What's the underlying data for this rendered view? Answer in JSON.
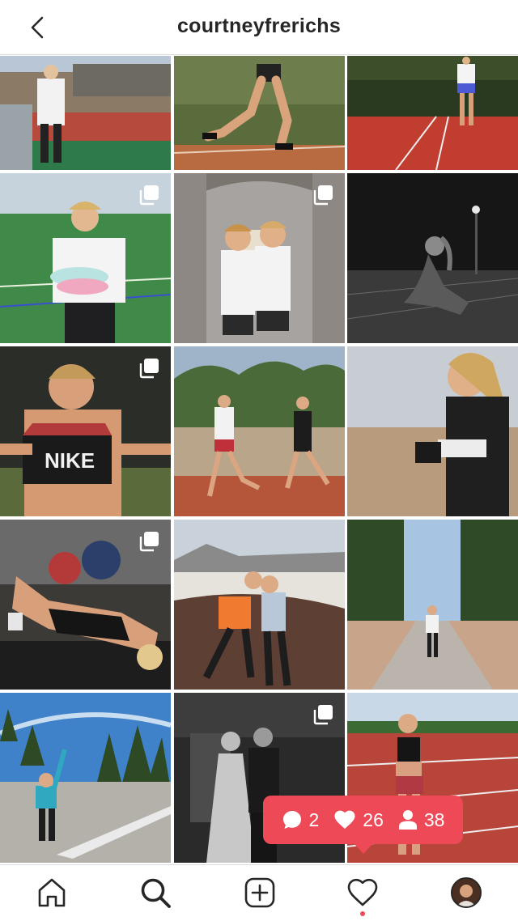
{
  "header": {
    "username": "courtneyfrerichs",
    "back_icon": "chevron-left-icon"
  },
  "grid": {
    "posts": [
      {
        "name": "stadium-portrait",
        "multi": false
      },
      {
        "name": "runner-legs-track",
        "multi": false
      },
      {
        "name": "runner-distant-track",
        "multi": false
      },
      {
        "name": "shoes-field",
        "multi": true
      },
      {
        "name": "friends-bridge",
        "multi": true
      },
      {
        "name": "night-crouch",
        "multi": false
      },
      {
        "name": "nike-top-smile",
        "multi": true
      },
      {
        "name": "two-runners-track",
        "multi": false
      },
      {
        "name": "black-vest-closeup",
        "multi": false
      },
      {
        "name": "stretching-gym",
        "multi": true
      },
      {
        "name": "muddy-road-friends",
        "multi": false
      },
      {
        "name": "forest-road-run",
        "multi": false
      },
      {
        "name": "road-pines-jump",
        "multi": false
      },
      {
        "name": "formal-bw-photo",
        "multi": true
      },
      {
        "name": "track-standing",
        "multi": false
      }
    ]
  },
  "activity": {
    "comments": "2",
    "likes": "26",
    "followers": "38",
    "color": "#ed4956"
  },
  "tabbar": {
    "items": [
      "home-icon",
      "search-icon",
      "new-post-icon",
      "activity-heart-icon",
      "profile-avatar"
    ],
    "notification_color": "#ed4956"
  }
}
